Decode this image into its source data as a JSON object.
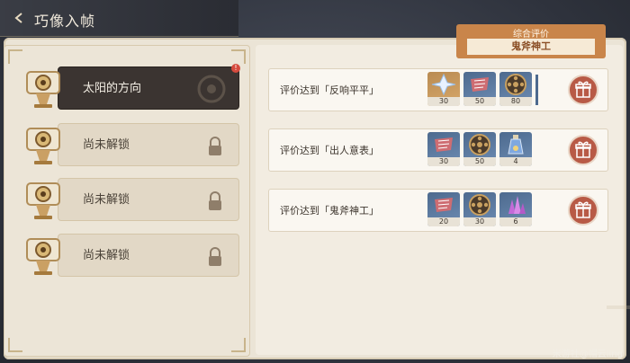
{
  "header": {
    "title": "巧像入帧"
  },
  "levels": [
    {
      "label": "太阳的方向",
      "selected": true,
      "badge": "!"
    },
    {
      "label": "尚未解锁",
      "locked": true
    },
    {
      "label": "尚未解锁",
      "locked": true
    },
    {
      "label": "尚未解锁",
      "locked": true
    }
  ],
  "overall": {
    "label": "综合评价",
    "value": "鬼斧神工"
  },
  "tasks": [
    {
      "text": "评价达到「反响平平」",
      "rewards": [
        {
          "icon": "primogem-icon",
          "qty": "30"
        },
        {
          "icon": "mora-icon",
          "qty": "50"
        },
        {
          "icon": "film-reel-icon",
          "qty": "80"
        }
      ]
    },
    {
      "text": "评价达到「出人意表」",
      "rewards": [
        {
          "icon": "mora-icon",
          "qty": "30"
        },
        {
          "icon": "film-reel-icon",
          "qty": "50"
        },
        {
          "icon": "potion-icon",
          "qty": "4"
        }
      ]
    },
    {
      "text": "评价达到「鬼斧神工」",
      "rewards": [
        {
          "icon": "mora-icon",
          "qty": "20"
        },
        {
          "icon": "film-reel-icon",
          "qty": "30"
        },
        {
          "icon": "crystal-icon",
          "qty": "6"
        }
      ]
    }
  ],
  "watermark": "米游社@帽云ling",
  "colors": {
    "accent": "#c9854a",
    "gift": "#b85a46",
    "selected": "#3b3431"
  }
}
